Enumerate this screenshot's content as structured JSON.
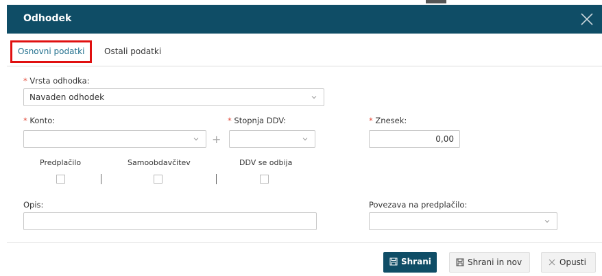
{
  "dialog": {
    "title": "Odhodek",
    "close_icon": "close-icon"
  },
  "tabs": [
    {
      "label": "Osnovni podatki",
      "active": true
    },
    {
      "label": "Ostali podatki",
      "active": false
    }
  ],
  "form": {
    "required_marker": "*",
    "vrsta_odhodka": {
      "label": "Vrsta odhodka:",
      "value": "Navaden odhodek"
    },
    "konto": {
      "label": "Konto:",
      "value": ""
    },
    "stopnja_ddv": {
      "label": "Stopnja DDV:",
      "value": ""
    },
    "znesek": {
      "label": "Znesek:",
      "value": "0,00"
    },
    "plus_sign": "+",
    "checkboxes": [
      {
        "label": "Predplačilo",
        "checked": false
      },
      {
        "label": "Samoobdavčitev",
        "checked": false
      },
      {
        "label": "DDV se odbija",
        "checked": false
      }
    ],
    "opis": {
      "label": "Opis:",
      "value": ""
    },
    "povezava": {
      "label": "Povezava na predplačilo:",
      "value": ""
    }
  },
  "buttons": {
    "save": "Shrani",
    "save_new": "Shrani in nov",
    "cancel": "Opusti"
  },
  "colors": {
    "header": "#0f4d66",
    "required": "#e24b3b",
    "active_tab": "#1f6e8c",
    "highlight": "#e01010"
  }
}
